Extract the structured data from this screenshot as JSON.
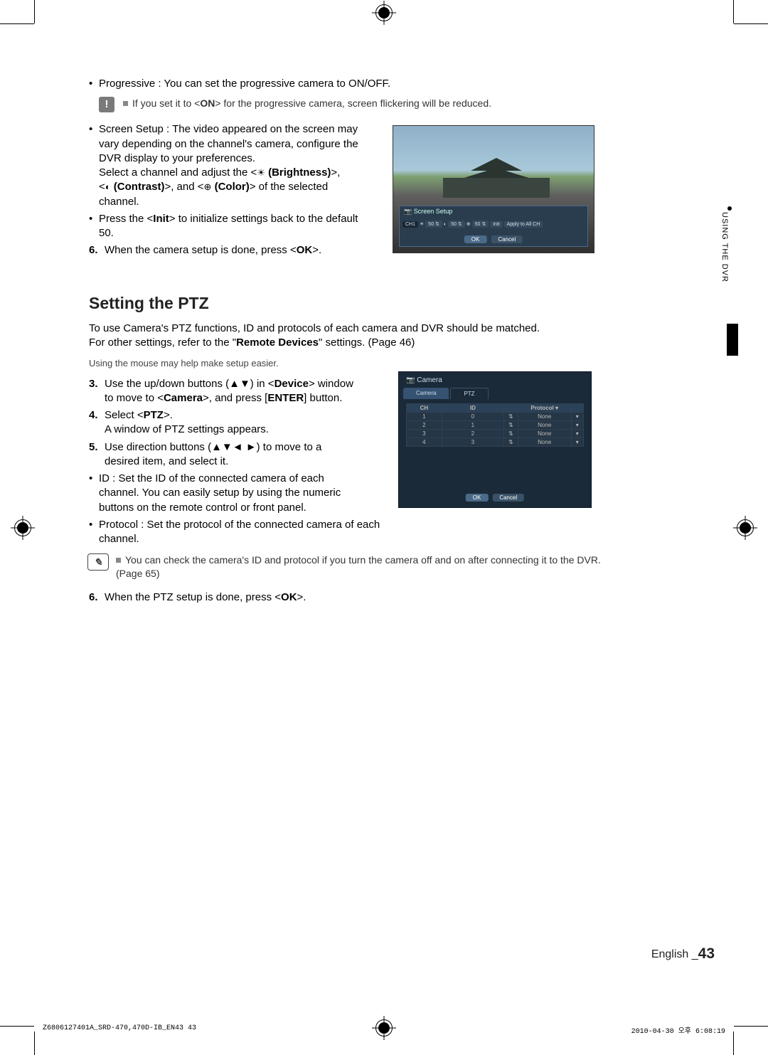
{
  "bullets": {
    "progressive": "Progressive : You can set the progressive camera to ON/OFF.",
    "warn_note": "If you set it to <ON> for the progressive camera, screen flickering will be reduced.",
    "screen_setup_1": "Screen Setup : The video appeared on the screen may vary depending on the channel's camera, configure the DVR display to your preferences.",
    "screen_setup_2": "Select a channel and adjust the <",
    "screen_setup_2b": " (Brightness)>,",
    "screen_setup_3a": "<",
    "screen_setup_3b": " (Contrast)>, and <",
    "screen_setup_3c": " (Color)> of the selected channel.",
    "init": "Press the <Init> to initialize settings back to the default 50.",
    "step6a": "When the camera setup is done, press <OK>."
  },
  "ptz": {
    "heading": "Setting the PTZ",
    "intro1": "To use Camera's PTZ functions, ID and protocols of each camera and DVR should be matched.",
    "intro2": "For other settings, refer to the \"Remote Devices\" settings. (Page 46)",
    "mouse": "Using the mouse may help make setup easier.",
    "step3": "Use the up/down buttons (▲▼) in <Device> window to move to <Camera>, and press [ENTER] button.",
    "step4a": "Select <PTZ>.",
    "step4b": "A window of PTZ settings appears.",
    "step5": "Use direction buttons (▲▼◄ ►) to move to a desired item, and select it.",
    "id_bullet": "ID : Set the ID of the connected camera of each channel. You can easily setup by using the numeric buttons on the remote control or front panel.",
    "protocol_bullet": "Protocol : Set the protocol of the connected camera of each channel.",
    "note": "You can check the camera's ID and protocol if you turn the camera off and on after connecting it to the DVR. (Page 65)",
    "step6": "When the PTZ setup is done, press <OK>."
  },
  "sidebar": "USING THE DVR",
  "footer": {
    "lang": "English _",
    "page": "43"
  },
  "bottom": {
    "left": "Z6806127401A_SRD-470,470D-IB_EN43   43",
    "right": "2010-04-30   오후 6:08:19"
  },
  "ss1": {
    "title": "Screen Setup",
    "ch": "CH1",
    "v50a": "50",
    "v50b": "50",
    "v50c": "50",
    "init": "Init",
    "apply": "Apply to All CH",
    "ok": "OK",
    "cancel": "Cancel"
  },
  "ss2": {
    "title": "Camera",
    "tab_cam": "Camera",
    "tab_ptz": "PTZ",
    "h_ch": "CH",
    "h_id": "ID",
    "h_proto": "Protocol ▾",
    "rows": [
      {
        "ch": "1",
        "id": "0",
        "proto": "None"
      },
      {
        "ch": "2",
        "id": "1",
        "proto": "None"
      },
      {
        "ch": "3",
        "id": "2",
        "proto": "None"
      },
      {
        "ch": "4",
        "id": "3",
        "proto": "None"
      }
    ],
    "ok": "OK",
    "cancel": "Cancel"
  }
}
